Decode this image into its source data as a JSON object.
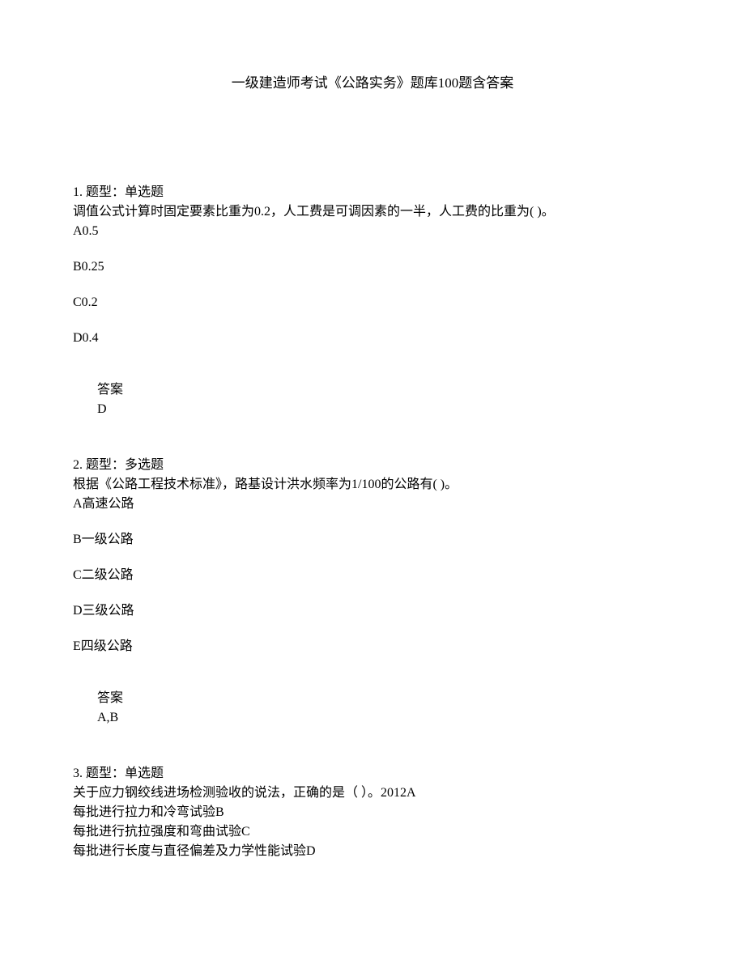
{
  "title": "一级建造师考试《公路实务》题库100题含答案",
  "q1": {
    "header": "1. 题型：单选题",
    "text": "调值公式计算时固定要素比重为0.2，人工费是可调因素的一半，人工费的比重为( )。",
    "optA": "A0.5",
    "optB": "B0.25",
    "optC": "C0.2",
    "optD": "D0.4",
    "answerLabel": "答案",
    "answerValue": "D"
  },
  "q2": {
    "header": "2. 题型：多选题",
    "text": "根据《公路工程技术标准》，路基设计洪水频率为1/100的公路有( )。",
    "optA": "A高速公路",
    "optB": "B一级公路",
    "optC": "C二级公路",
    "optD": "D三级公路",
    "optE": "E四级公路",
    "answerLabel": "答案",
    "answerValue": "A,B"
  },
  "q3": {
    "header": "3. 题型：单选题",
    "line1": "关于应力钢绞线进场检测验收的说法，正确的是（ ）。2012A",
    "line2": "每批进行拉力和冷弯试验B",
    "line3": "每批进行抗拉强度和弯曲试验C",
    "line4": "每批进行长度与直径偏差及力学性能试验D"
  }
}
